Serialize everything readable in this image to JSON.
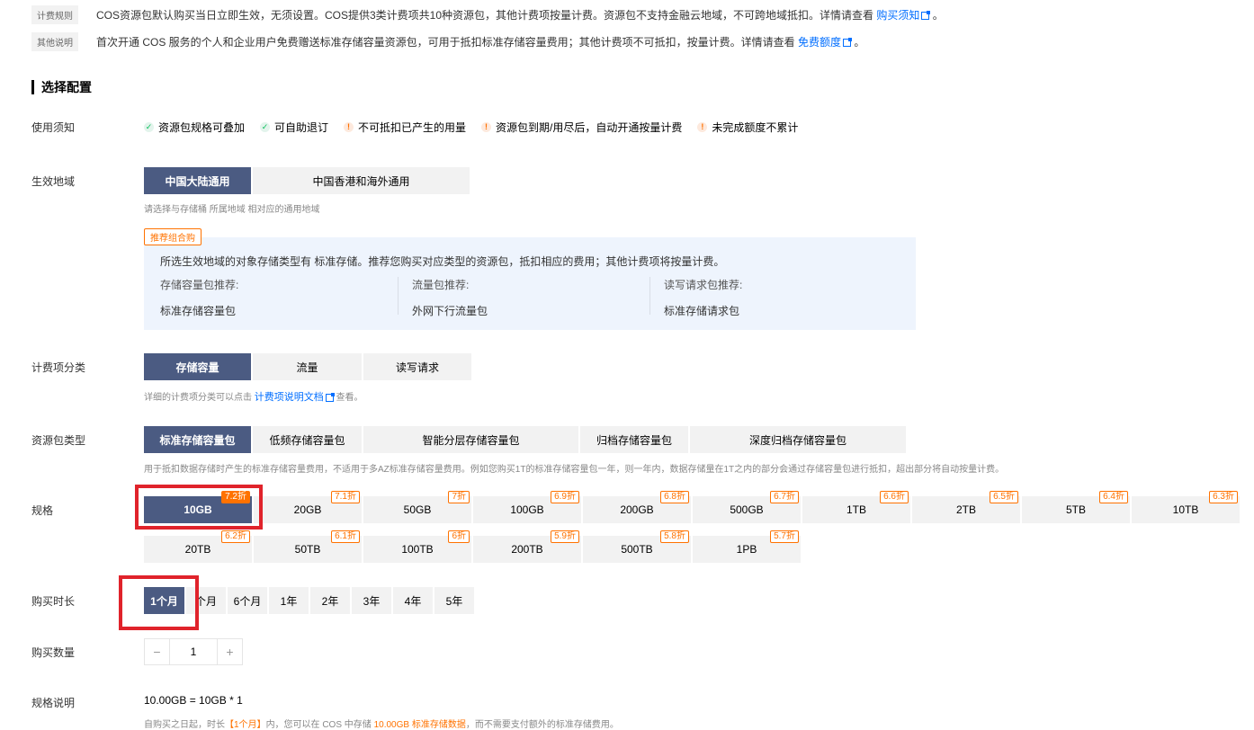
{
  "notices": [
    {
      "tag": "计费规则",
      "text": "COS资源包默认购买当日立即生效，无须设置。COS提供3类计费项共10种资源包，其他计费项按量计费。资源包不支持金融云地域，不可跨地域抵扣。详情请查看 ",
      "link": "购买须知",
      "tail": "。"
    },
    {
      "tag": "其他说明",
      "text": "首次开通 COS 服务的个人和企业用户免费赠送标准存储容量资源包，可用于抵扣标准存储容量费用；其他计费项不可抵扣，按量计费。详情请查看 ",
      "link": "免费额度",
      "tail": "。"
    }
  ],
  "section_title": "选择配置",
  "usage": {
    "label": "使用须知",
    "tips": [
      {
        "type": "ok",
        "icon": "check-icon",
        "text": "资源包规格可叠加"
      },
      {
        "type": "ok",
        "icon": "check-icon",
        "text": "可自助退订"
      },
      {
        "type": "warn",
        "icon": "info-icon",
        "text": "不可抵扣已产生的用量"
      },
      {
        "type": "warn",
        "icon": "info-icon",
        "text": "资源包到期/用尽后，自动开通按量计费"
      },
      {
        "type": "warn",
        "icon": "info-icon",
        "text": "未完成额度不累计"
      }
    ]
  },
  "region": {
    "label": "生效地域",
    "options": [
      "中国大陆通用",
      "中国香港和海外通用"
    ],
    "selected": "中国大陆通用",
    "hint": "请选择与存储桶 所属地域 相对应的通用地域"
  },
  "promo": {
    "tag": "推荐组合购",
    "desc": "所选生效地域的对象存储类型有 标准存储。推荐您购买对应类型的资源包，抵扣相应的费用；其他计费项将按量计费。",
    "cols": [
      {
        "title": "存储容量包推荐:",
        "value": "标准存储容量包"
      },
      {
        "title": "流量包推荐:",
        "value": "外网下行流量包"
      },
      {
        "title": "读写请求包推荐:",
        "value": "标准存储请求包"
      }
    ]
  },
  "billing": {
    "label": "计费项分类",
    "options": [
      "存储容量",
      "流量",
      "读写请求"
    ],
    "selected": "存储容量",
    "hint_prefix": "详细的计费项分类可以点击 ",
    "hint_link": "计费项说明文档",
    "hint_suffix": " 查看。"
  },
  "package_type": {
    "label": "资源包类型",
    "options": [
      "标准存储容量包",
      "低频存储容量包",
      "智能分层存储容量包",
      "归档存储容量包",
      "深度归档存储容量包"
    ],
    "selected": "标准存储容量包",
    "hint": "用于抵扣数据存储时产生的标准存储容量费用，不适用于多AZ标准存储容量费用。例如您购买1T的标准存储容量包一年，则一年内，数据存储量在1T之内的部分会通过存储容量包进行抵扣，超出部分将自动按量计费。"
  },
  "spec": {
    "label": "规格",
    "selected": "10GB",
    "items": [
      {
        "size": "10GB",
        "discount": "7.2折"
      },
      {
        "size": "20GB",
        "discount": "7.1折"
      },
      {
        "size": "50GB",
        "discount": "7折"
      },
      {
        "size": "100GB",
        "discount": "6.9折"
      },
      {
        "size": "200GB",
        "discount": "6.8折"
      },
      {
        "size": "500GB",
        "discount": "6.7折"
      },
      {
        "size": "1TB",
        "discount": "6.6折"
      },
      {
        "size": "2TB",
        "discount": "6.5折"
      },
      {
        "size": "5TB",
        "discount": "6.4折"
      },
      {
        "size": "10TB",
        "discount": "6.3折"
      },
      {
        "size": "20TB",
        "discount": "6.2折"
      },
      {
        "size": "50TB",
        "discount": "6.1折"
      },
      {
        "size": "100TB",
        "discount": "6折"
      },
      {
        "size": "200TB",
        "discount": "5.9折"
      },
      {
        "size": "500TB",
        "discount": "5.8折"
      },
      {
        "size": "1PB",
        "discount": "5.7折"
      }
    ]
  },
  "duration": {
    "label": "购买时长",
    "options": [
      "1个月",
      "个月",
      "6个月",
      "1年",
      "2年",
      "3年",
      "4年",
      "5年"
    ],
    "selected": "1个月"
  },
  "quantity": {
    "label": "购买数量",
    "minus": "−",
    "value": "1",
    "plus": "+"
  },
  "spec_desc": {
    "label": "规格说明",
    "formula": "10.00GB = 10GB * 1",
    "foot_1": "自购买之日起，时长",
    "foot_duration": "【1个月】",
    "foot_2": "内，您可以在 COS 中存储 ",
    "foot_amount": "10.00GB 标准存储数据",
    "foot_3": "，而不需要支付额外的标准存储费用。"
  },
  "colors": {
    "accent": "#4b5b82",
    "link": "#006eff",
    "discount": "#ff7200",
    "highlight_box": "#e0232b"
  }
}
